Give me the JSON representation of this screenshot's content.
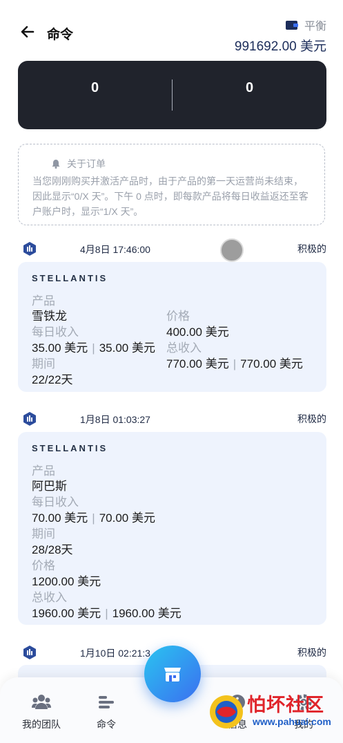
{
  "header": {
    "title": "命令",
    "balance_label": "平衡",
    "balance_value": "991692.00 美元"
  },
  "stats": {
    "left": "0",
    "right": "0"
  },
  "notice": {
    "title": "关于订单",
    "text": "当您刚刚购买并激活产品时，由于产品的第一天运营尚未结束，因此显示“0/X 天”。下午 0 点时，即每款产品将每日收益返还至客户账户时，显示“1/X 天”。"
  },
  "orders": [
    {
      "date": "4月8日 17:46:00",
      "status": "积极的",
      "brand": "STELLANTIS",
      "product_label": "产品",
      "product": "雪铁龙",
      "daily_label": "每日收入",
      "daily_a": "35.00 美元",
      "daily_b": "35.00 美元",
      "period_label": "期间",
      "period": "22/22天",
      "price_label": "价格",
      "price": "400.00 美元",
      "total_label": "总收入",
      "total_a": "770.00 美元",
      "total_b": "770.00 美元"
    },
    {
      "date": "1月8日 01:03:27",
      "status": "积极的",
      "brand": "STELLANTIS",
      "product_label": "产品",
      "product": "阿巴斯",
      "daily_label": "每日收入",
      "daily_a": "70.00 美元",
      "daily_b": "70.00 美元",
      "period_label": "期间",
      "period": "28/28天",
      "price_label": "价格",
      "price": "1200.00 美元",
      "total_label": "总收入",
      "total_a": "1960.00 美元",
      "total_b": "1960.00 美元"
    },
    {
      "date": "1月10日 02:21:3",
      "status": "积极的"
    }
  ],
  "nav": {
    "team": "我的团队",
    "orders": "命令",
    "info": "信息",
    "settings": "我的"
  },
  "watermark": {
    "text": "怕坏社区",
    "url": "www.pahuai.com"
  },
  "colors": {
    "accent": "#3b6ff0",
    "card_dark": "#20232c",
    "card_light": "#eef3fd"
  }
}
